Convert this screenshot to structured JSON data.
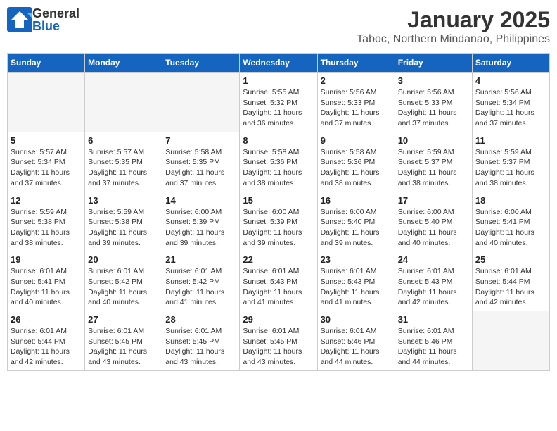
{
  "header": {
    "logo_general": "General",
    "logo_blue": "Blue",
    "title": "January 2025",
    "subtitle": "Taboc, Northern Mindanao, Philippines"
  },
  "calendar": {
    "days": [
      "Sunday",
      "Monday",
      "Tuesday",
      "Wednesday",
      "Thursday",
      "Friday",
      "Saturday"
    ],
    "weeks": [
      [
        {
          "date": "",
          "sunrise": "",
          "sunset": "",
          "daylight": "",
          "empty": true
        },
        {
          "date": "",
          "sunrise": "",
          "sunset": "",
          "daylight": "",
          "empty": true
        },
        {
          "date": "",
          "sunrise": "",
          "sunset": "",
          "daylight": "",
          "empty": true
        },
        {
          "date": "1",
          "sunrise": "Sunrise: 5:55 AM",
          "sunset": "Sunset: 5:32 PM",
          "daylight": "Daylight: 11 hours and 36 minutes.",
          "empty": false
        },
        {
          "date": "2",
          "sunrise": "Sunrise: 5:56 AM",
          "sunset": "Sunset: 5:33 PM",
          "daylight": "Daylight: 11 hours and 37 minutes.",
          "empty": false
        },
        {
          "date": "3",
          "sunrise": "Sunrise: 5:56 AM",
          "sunset": "Sunset: 5:33 PM",
          "daylight": "Daylight: 11 hours and 37 minutes.",
          "empty": false
        },
        {
          "date": "4",
          "sunrise": "Sunrise: 5:56 AM",
          "sunset": "Sunset: 5:34 PM",
          "daylight": "Daylight: 11 hours and 37 minutes.",
          "empty": false
        }
      ],
      [
        {
          "date": "5",
          "sunrise": "Sunrise: 5:57 AM",
          "sunset": "Sunset: 5:34 PM",
          "daylight": "Daylight: 11 hours and 37 minutes.",
          "empty": false
        },
        {
          "date": "6",
          "sunrise": "Sunrise: 5:57 AM",
          "sunset": "Sunset: 5:35 PM",
          "daylight": "Daylight: 11 hours and 37 minutes.",
          "empty": false
        },
        {
          "date": "7",
          "sunrise": "Sunrise: 5:58 AM",
          "sunset": "Sunset: 5:35 PM",
          "daylight": "Daylight: 11 hours and 37 minutes.",
          "empty": false
        },
        {
          "date": "8",
          "sunrise": "Sunrise: 5:58 AM",
          "sunset": "Sunset: 5:36 PM",
          "daylight": "Daylight: 11 hours and 38 minutes.",
          "empty": false
        },
        {
          "date": "9",
          "sunrise": "Sunrise: 5:58 AM",
          "sunset": "Sunset: 5:36 PM",
          "daylight": "Daylight: 11 hours and 38 minutes.",
          "empty": false
        },
        {
          "date": "10",
          "sunrise": "Sunrise: 5:59 AM",
          "sunset": "Sunset: 5:37 PM",
          "daylight": "Daylight: 11 hours and 38 minutes.",
          "empty": false
        },
        {
          "date": "11",
          "sunrise": "Sunrise: 5:59 AM",
          "sunset": "Sunset: 5:37 PM",
          "daylight": "Daylight: 11 hours and 38 minutes.",
          "empty": false
        }
      ],
      [
        {
          "date": "12",
          "sunrise": "Sunrise: 5:59 AM",
          "sunset": "Sunset: 5:38 PM",
          "daylight": "Daylight: 11 hours and 38 minutes.",
          "empty": false
        },
        {
          "date": "13",
          "sunrise": "Sunrise: 5:59 AM",
          "sunset": "Sunset: 5:38 PM",
          "daylight": "Daylight: 11 hours and 39 minutes.",
          "empty": false
        },
        {
          "date": "14",
          "sunrise": "Sunrise: 6:00 AM",
          "sunset": "Sunset: 5:39 PM",
          "daylight": "Daylight: 11 hours and 39 minutes.",
          "empty": false
        },
        {
          "date": "15",
          "sunrise": "Sunrise: 6:00 AM",
          "sunset": "Sunset: 5:39 PM",
          "daylight": "Daylight: 11 hours and 39 minutes.",
          "empty": false
        },
        {
          "date": "16",
          "sunrise": "Sunrise: 6:00 AM",
          "sunset": "Sunset: 5:40 PM",
          "daylight": "Daylight: 11 hours and 39 minutes.",
          "empty": false
        },
        {
          "date": "17",
          "sunrise": "Sunrise: 6:00 AM",
          "sunset": "Sunset: 5:40 PM",
          "daylight": "Daylight: 11 hours and 40 minutes.",
          "empty": false
        },
        {
          "date": "18",
          "sunrise": "Sunrise: 6:00 AM",
          "sunset": "Sunset: 5:41 PM",
          "daylight": "Daylight: 11 hours and 40 minutes.",
          "empty": false
        }
      ],
      [
        {
          "date": "19",
          "sunrise": "Sunrise: 6:01 AM",
          "sunset": "Sunset: 5:41 PM",
          "daylight": "Daylight: 11 hours and 40 minutes.",
          "empty": false
        },
        {
          "date": "20",
          "sunrise": "Sunrise: 6:01 AM",
          "sunset": "Sunset: 5:42 PM",
          "daylight": "Daylight: 11 hours and 40 minutes.",
          "empty": false
        },
        {
          "date": "21",
          "sunrise": "Sunrise: 6:01 AM",
          "sunset": "Sunset: 5:42 PM",
          "daylight": "Daylight: 11 hours and 41 minutes.",
          "empty": false
        },
        {
          "date": "22",
          "sunrise": "Sunrise: 6:01 AM",
          "sunset": "Sunset: 5:43 PM",
          "daylight": "Daylight: 11 hours and 41 minutes.",
          "empty": false
        },
        {
          "date": "23",
          "sunrise": "Sunrise: 6:01 AM",
          "sunset": "Sunset: 5:43 PM",
          "daylight": "Daylight: 11 hours and 41 minutes.",
          "empty": false
        },
        {
          "date": "24",
          "sunrise": "Sunrise: 6:01 AM",
          "sunset": "Sunset: 5:43 PM",
          "daylight": "Daylight: 11 hours and 42 minutes.",
          "empty": false
        },
        {
          "date": "25",
          "sunrise": "Sunrise: 6:01 AM",
          "sunset": "Sunset: 5:44 PM",
          "daylight": "Daylight: 11 hours and 42 minutes.",
          "empty": false
        }
      ],
      [
        {
          "date": "26",
          "sunrise": "Sunrise: 6:01 AM",
          "sunset": "Sunset: 5:44 PM",
          "daylight": "Daylight: 11 hours and 42 minutes.",
          "empty": false
        },
        {
          "date": "27",
          "sunrise": "Sunrise: 6:01 AM",
          "sunset": "Sunset: 5:45 PM",
          "daylight": "Daylight: 11 hours and 43 minutes.",
          "empty": false
        },
        {
          "date": "28",
          "sunrise": "Sunrise: 6:01 AM",
          "sunset": "Sunset: 5:45 PM",
          "daylight": "Daylight: 11 hours and 43 minutes.",
          "empty": false
        },
        {
          "date": "29",
          "sunrise": "Sunrise: 6:01 AM",
          "sunset": "Sunset: 5:45 PM",
          "daylight": "Daylight: 11 hours and 43 minutes.",
          "empty": false
        },
        {
          "date": "30",
          "sunrise": "Sunrise: 6:01 AM",
          "sunset": "Sunset: 5:46 PM",
          "daylight": "Daylight: 11 hours and 44 minutes.",
          "empty": false
        },
        {
          "date": "31",
          "sunrise": "Sunrise: 6:01 AM",
          "sunset": "Sunset: 5:46 PM",
          "daylight": "Daylight: 11 hours and 44 minutes.",
          "empty": false
        },
        {
          "date": "",
          "sunrise": "",
          "sunset": "",
          "daylight": "",
          "empty": true
        }
      ]
    ]
  }
}
